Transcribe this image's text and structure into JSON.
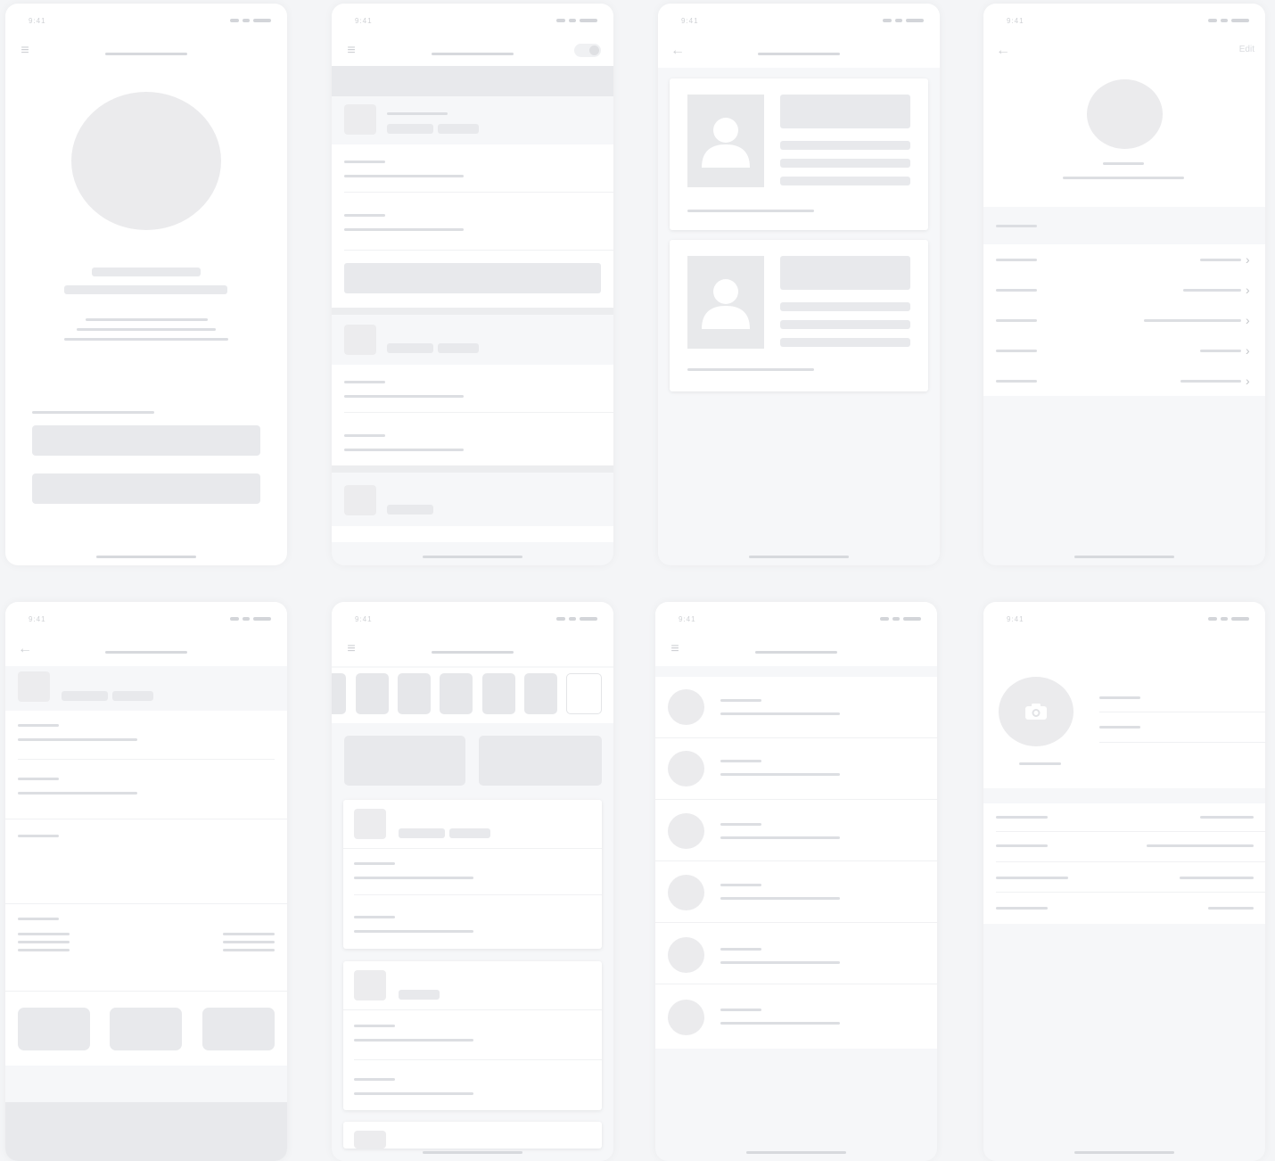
{
  "status_bar": {
    "time": "9:41"
  },
  "profile_edit": {
    "edit_label": "Edit"
  },
  "icons": {
    "menu": "menu-icon",
    "back": "back-arrow-icon",
    "chevron": "chevron-right-icon",
    "camera": "camera-icon",
    "person": "person-placeholder-icon"
  },
  "colors": {
    "background": "#f4f5f7",
    "surface": "#ffffff",
    "placeholder": "#e8e9ec",
    "line": "#dcdee2"
  }
}
